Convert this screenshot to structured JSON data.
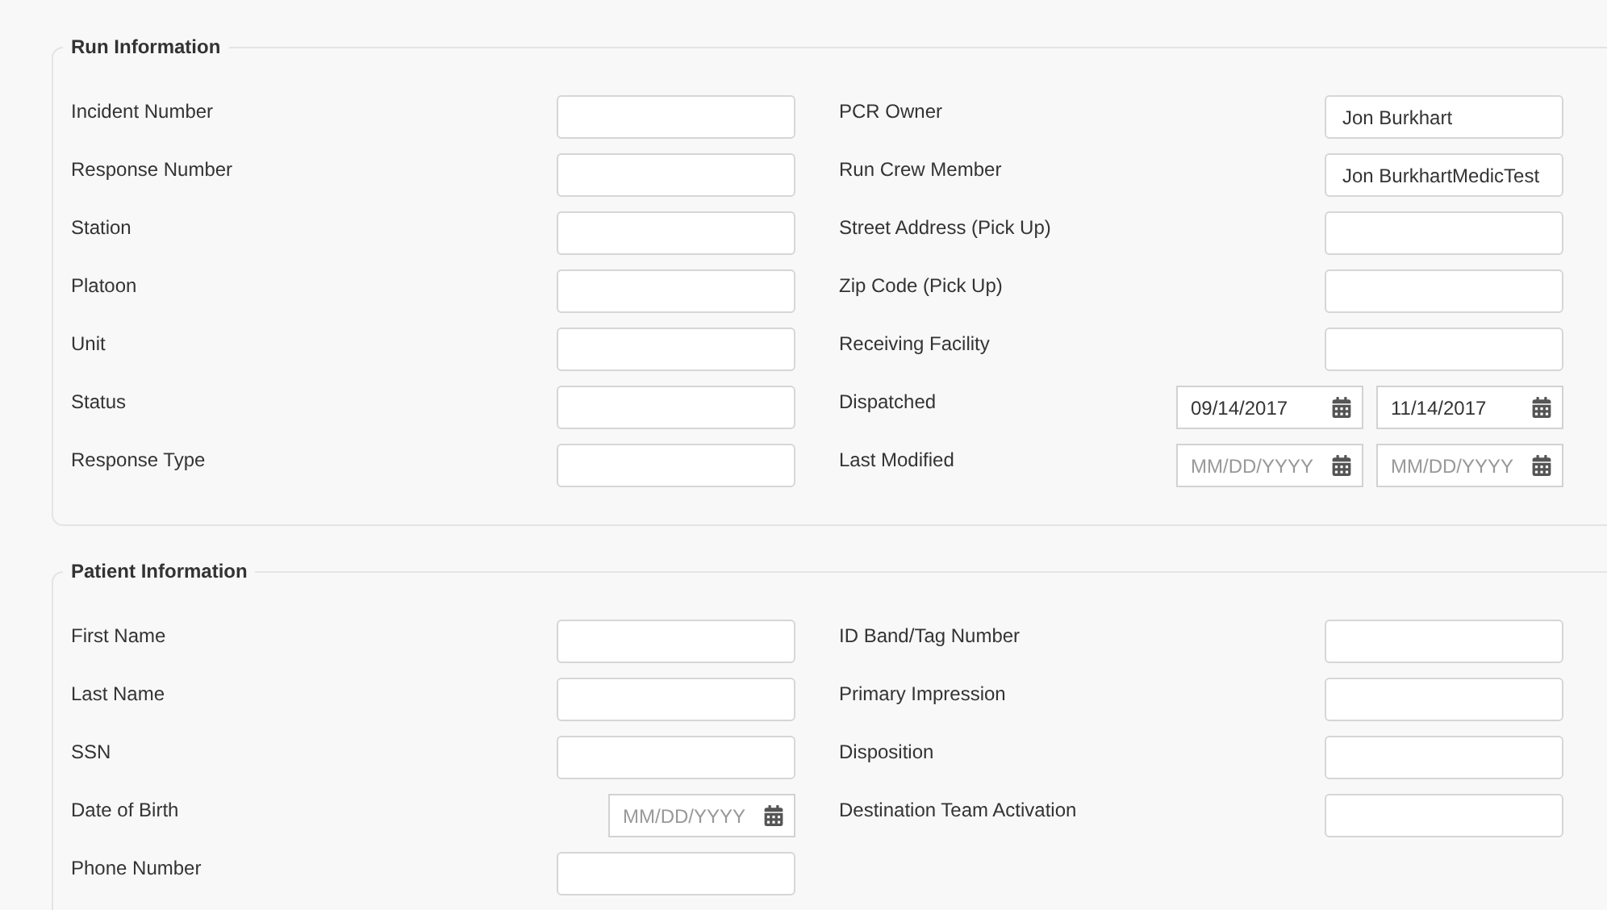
{
  "sections": [
    {
      "legend": "Run Information",
      "left": [
        {
          "label": "Incident Number",
          "inputs": [
            {
              "kind": "text"
            }
          ]
        },
        {
          "label": "Response Number",
          "inputs": [
            {
              "kind": "text"
            }
          ]
        },
        {
          "label": "Station",
          "inputs": [
            {
              "kind": "text"
            }
          ]
        },
        {
          "label": "Platoon",
          "inputs": [
            {
              "kind": "text"
            }
          ]
        },
        {
          "label": "Unit",
          "inputs": [
            {
              "kind": "text"
            }
          ]
        },
        {
          "label": "Status",
          "inputs": [
            {
              "kind": "text"
            }
          ]
        },
        {
          "label": "Response Type",
          "inputs": [
            {
              "kind": "text"
            }
          ]
        }
      ],
      "right": [
        {
          "label": "PCR Owner",
          "inputs": [
            {
              "kind": "text",
              "value": "Jon Burkhart"
            }
          ]
        },
        {
          "label": "Run Crew Member",
          "inputs": [
            {
              "kind": "text",
              "value": "Jon BurkhartMedicTest"
            }
          ]
        },
        {
          "label": "Street Address (Pick Up)",
          "inputs": [
            {
              "kind": "text"
            }
          ]
        },
        {
          "label": "Zip Code (Pick Up)",
          "inputs": [
            {
              "kind": "text"
            }
          ]
        },
        {
          "label": "Receiving Facility",
          "inputs": [
            {
              "kind": "text"
            }
          ]
        },
        {
          "label": "Dispatched",
          "inputs": [
            {
              "kind": "date",
              "value": "09/14/2017"
            },
            {
              "kind": "date",
              "value": "11/14/2017"
            }
          ]
        },
        {
          "label": "Last Modified",
          "inputs": [
            {
              "kind": "date",
              "placeholder": "MM/DD/YYYY"
            },
            {
              "kind": "date",
              "placeholder": "MM/DD/YYYY"
            }
          ]
        }
      ]
    },
    {
      "legend": "Patient Information",
      "left": [
        {
          "label": "First Name",
          "inputs": [
            {
              "kind": "text"
            }
          ]
        },
        {
          "label": "Last Name",
          "inputs": [
            {
              "kind": "text"
            }
          ]
        },
        {
          "label": "SSN",
          "inputs": [
            {
              "kind": "text"
            }
          ]
        },
        {
          "label": "Date of Birth",
          "inputs": [
            {
              "kind": "date",
              "placeholder": "MM/DD/YYYY"
            }
          ]
        },
        {
          "label": "Phone Number",
          "inputs": [
            {
              "kind": "text"
            }
          ]
        }
      ],
      "right": [
        {
          "label": "ID Band/Tag Number",
          "inputs": [
            {
              "kind": "text"
            }
          ]
        },
        {
          "label": "Primary Impression",
          "inputs": [
            {
              "kind": "text"
            }
          ]
        },
        {
          "label": "Disposition",
          "inputs": [
            {
              "kind": "text"
            }
          ]
        },
        {
          "label": "Destination Team Activation",
          "inputs": [
            {
              "kind": "text"
            }
          ]
        }
      ]
    }
  ]
}
